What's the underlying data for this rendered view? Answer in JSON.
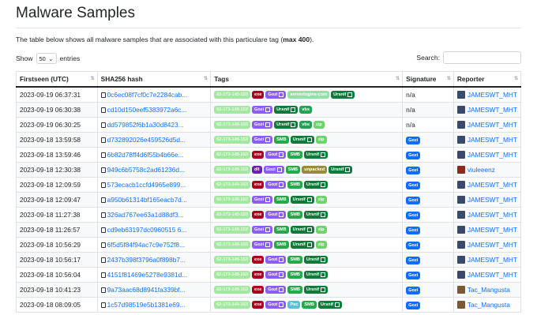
{
  "page": {
    "title": "Malware Samples",
    "intro_text": "The table below shows all malware samples that are associated with this particulare tag (",
    "intro_bold": "max 400",
    "intro_end": ")."
  },
  "controls": {
    "show_label": "Show",
    "page_size": "50",
    "entries_label": "entries",
    "search_label": "Search:"
  },
  "table": {
    "headers": [
      "Firstseen (UTC)",
      "SHA256 hash",
      "Tags",
      "Signature",
      "Reporter"
    ],
    "rows": [
      {
        "date": "2023-09-19 06:37:31",
        "hash": "0c6ec08f7cf0c7e2284cab...",
        "tags": [
          "62-173-145-153",
          "exe",
          "Gozi",
          "serverlogins-com",
          "Ursnif"
        ],
        "sig": "n/a",
        "reporter": "JAMESWT_MHT",
        "avatar": "#3a4a6b"
      },
      {
        "date": "2023-09-19 06:30:38",
        "hash": "cd10d150eef5383972a6c...",
        "tags": [
          "62-173-145-153",
          "Gozi",
          "Ursnif",
          "vbs"
        ],
        "sig": "n/a",
        "reporter": "JAMESWT_MHT",
        "avatar": "#3a4a6b"
      },
      {
        "date": "2023-09-19 06:30:25",
        "hash": "dd579852f6b1a30d8423...",
        "tags": [
          "62-173-145-153",
          "Gozi",
          "Ursnif",
          "vbs",
          "zip"
        ],
        "sig": "n/a",
        "reporter": "JAMESWT_MHT",
        "avatar": "#3a4a6b"
      },
      {
        "date": "2023-09-18 13:59:58",
        "hash": "d732892026e459526d5d...",
        "tags": [
          "62-173-145-153",
          "Gozi",
          "SMB",
          "Ursnif",
          "zip"
        ],
        "sig": "Gozi",
        "reporter": "JAMESWT_MHT",
        "avatar": "#3a4a6b"
      },
      {
        "date": "2023-09-18 13:59:46",
        "hash": "6b82d78ff4d6f55b4b66e...",
        "tags": [
          "62-173-145-153",
          "exe",
          "Gozi",
          "SMB",
          "Ursnif"
        ],
        "sig": "Gozi",
        "reporter": "JAMESWT_MHT",
        "avatar": "#3a4a6b"
      },
      {
        "date": "2023-09-18 12:30:38",
        "hash": "949c6b5758c2ad61236d...",
        "tags": [
          "62-173-145-153",
          "dll",
          "Gozi",
          "SMB",
          "unpacked",
          "Ursnif"
        ],
        "sig": "Gozi",
        "reporter": "viuleeenz",
        "avatar": "#8b2b1e"
      },
      {
        "date": "2023-09-18 12:09:59",
        "hash": "573ecacb1ccfd4965e899...",
        "tags": [
          "62-173-145-153",
          "exe",
          "Gozi",
          "SMB",
          "Ursnif"
        ],
        "sig": "Gozi",
        "reporter": "JAMESWT_MHT",
        "avatar": "#3a4a6b"
      },
      {
        "date": "2023-09-18 12:09:47",
        "hash": "a950b61314bf165eacb7d...",
        "tags": [
          "62-173-145-153",
          "Gozi",
          "SMB",
          "Ursnif",
          "zip"
        ],
        "sig": "Gozi",
        "reporter": "JAMESWT_MHT",
        "avatar": "#3a4a6b"
      },
      {
        "date": "2023-09-18 11:27:38",
        "hash": "326ad767ee63a1d88df3...",
        "tags": [
          "62-173-145-153",
          "exe",
          "Gozi",
          "SMB",
          "Ursnif"
        ],
        "sig": "Gozi",
        "reporter": "JAMESWT_MHT",
        "avatar": "#3a4a6b"
      },
      {
        "date": "2023-09-18 11:26:57",
        "hash": "cd9eb63197dc0960515 6...",
        "tags": [
          "62-173-145-153",
          "Gozi",
          "SMB",
          "Ursnif",
          "zip"
        ],
        "sig": "Gozi",
        "reporter": "JAMESWT_MHT",
        "avatar": "#3a4a6b"
      },
      {
        "date": "2023-09-18 10:56:29",
        "hash": "6f5d5f84f94ac7c9e752f8...",
        "tags": [
          "62-173-145-153",
          "Gozi",
          "SMB",
          "Ursnif",
          "zip"
        ],
        "sig": "Gozi",
        "reporter": "JAMESWT_MHT",
        "avatar": "#3a4a6b"
      },
      {
        "date": "2023-09-18 10:56:17",
        "hash": "2437b398f3796a0f898b7...",
        "tags": [
          "62-173-145-153",
          "exe",
          "Gozi",
          "SMB",
          "Ursnif"
        ],
        "sig": "Gozi",
        "reporter": "JAMESWT_MHT",
        "avatar": "#3a4a6b"
      },
      {
        "date": "2023-09-18 10:56:04",
        "hash": "4151f81469e5278e9381d...",
        "tags": [
          "62-173-145-153",
          "exe",
          "Gozi",
          "SMB",
          "Ursnif"
        ],
        "sig": "Gozi",
        "reporter": "JAMESWT_MHT",
        "avatar": "#3a4a6b"
      },
      {
        "date": "2023-09-18 10:41:23",
        "hash": "9a73aac68d8941fa339bf...",
        "tags": [
          "62-173-145-153",
          "exe",
          "Gozi",
          "SMB",
          "Ursnif"
        ],
        "sig": "Gozi",
        "reporter": "Tac_Mangusta",
        "avatar": "#7a5a32"
      },
      {
        "date": "2023-09-18 08:09:05",
        "hash": "1c57d98519e5b1381e69...",
        "tags": [
          "62-173-145-153",
          "exe",
          "Gozi",
          "Pec",
          "SMB",
          "Ursnif"
        ],
        "sig": "Gozi",
        "reporter": "Tac_Mangusta",
        "avatar": "#7a5a32"
      }
    ]
  },
  "tag_colors": {
    "62-173-145-153": "#a3e8a0",
    "exe": "#b00020",
    "dll": "#6f1fb0",
    "Gozi": "#8b5cf6",
    "serverlogins-com": "#8fe3a8",
    "Ursnif": "#0f7a3a",
    "vbs": "#22a355",
    "zip": "#6ed36b",
    "SMB": "#27a84a",
    "unpacked": "#9a8a3c",
    "Pec": "#5cc0d8"
  },
  "linked_tags": [
    "Gozi",
    "Ursnif"
  ]
}
